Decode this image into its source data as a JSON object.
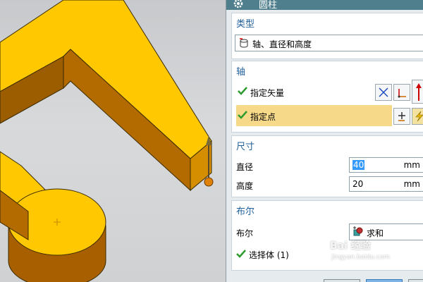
{
  "dialog": {
    "title": "圆柱",
    "type_group": {
      "title": "类型",
      "selected": "轴、直径和高度",
      "icon": "cylinder-icon"
    },
    "axis_group": {
      "title": "轴",
      "vector_label": "指定矢量",
      "point_label": "指定点"
    },
    "size_group": {
      "title": "尺寸",
      "diameter_label": "直径",
      "diameter_value": "40",
      "diameter_unit": "mm",
      "height_label": "高度",
      "height_value": "20",
      "height_unit": "mm"
    },
    "bool_group": {
      "title": "布尔",
      "bool_label": "布尔",
      "bool_value": "求和",
      "select_body_label": "选择体 (1)"
    }
  },
  "watermark": {
    "main": "Bai 经验",
    "sub": "jingyan.baidu.com"
  },
  "colors": {
    "accent": "#1f5f9a",
    "titlebar": "#4f7e8d",
    "highlight_row": "#f7d98a",
    "model_top": "#ffc800",
    "model_side": "#b36b00",
    "check": "#2e9b2e"
  }
}
